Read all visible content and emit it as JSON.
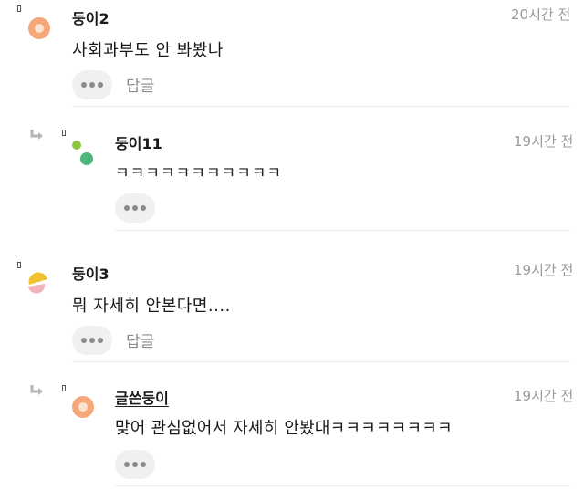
{
  "comments": [
    {
      "nickname": "둥이2",
      "time": "20시간 전",
      "text": "사회과부도 안 봐봤나",
      "reply_label": "답글",
      "is_reply": false
    },
    {
      "nickname": "둥이11",
      "time": "19시간 전",
      "text": "ㅋㅋㅋㅋㅋㅋㅋㅋㅋㅋㅋ",
      "is_reply": true
    },
    {
      "nickname": "둥이3",
      "time": "19시간 전",
      "text": "뭐 자세히 안본다면....",
      "reply_label": "답글",
      "is_reply": false
    },
    {
      "nickname": "글쓴둥이",
      "time": "19시간 전",
      "text": "맞어 관심없어서 자세히 안봤대ㅋㅋㅋㅋㅋㅋㅋㅋ",
      "is_reply": true,
      "is_author": true
    }
  ],
  "icons": {
    "more": "more-dots-icon",
    "reply_arrow": "reply-arrow-icon",
    "report_flag": "flag-icon"
  },
  "colors": {
    "avatar_orange": "#f5a77a",
    "avatar_green": "#4cb87a",
    "avatar_lime": "#8cc63f",
    "avatar_yellow": "#f2c12e",
    "avatar_pink": "#f0b3b8"
  }
}
